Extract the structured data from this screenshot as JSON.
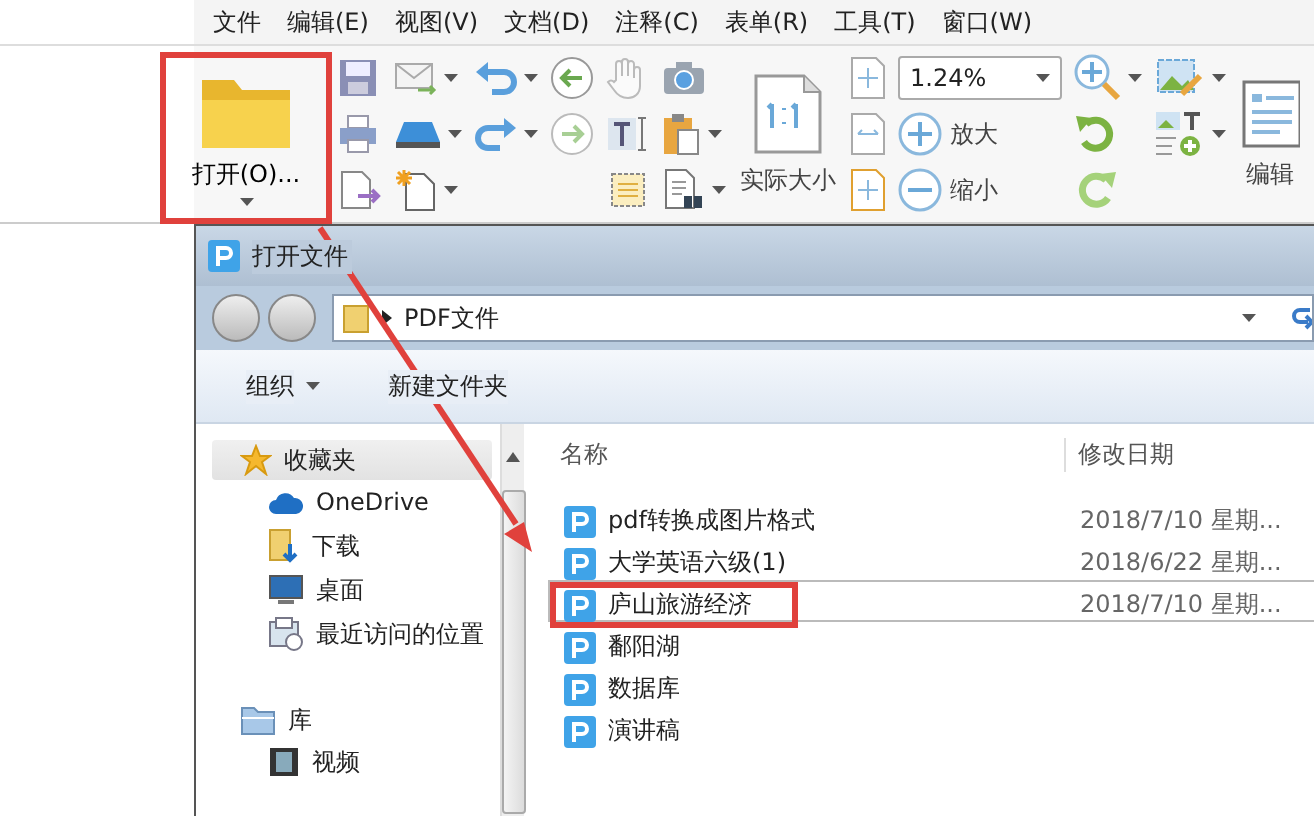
{
  "menu": [
    {
      "label": "文件"
    },
    {
      "label": "编辑(E)"
    },
    {
      "label": "视图(V)"
    },
    {
      "label": "文档(D)"
    },
    {
      "label": "注释(C)"
    },
    {
      "label": "表单(R)"
    },
    {
      "label": "工具(T)"
    },
    {
      "label": "窗口(W)"
    }
  ],
  "toolbar": {
    "open_button": {
      "label": "打开(O)...",
      "highlighted": true
    },
    "actual_size": {
      "label": "实际大小"
    },
    "zoom_field": {
      "value": "1.24%"
    },
    "zoom_in": {
      "label": "放大"
    },
    "zoom_out": {
      "label": "缩小"
    },
    "edit_button": {
      "label": "编辑"
    }
  },
  "dialog": {
    "title": "打开文件",
    "path": "PDF文件",
    "commands": [
      {
        "label": "组织",
        "dropdown": true
      },
      {
        "label": "新建文件夹",
        "dropdown": false
      }
    ],
    "nav": [
      {
        "label": "收藏夹",
        "selected": true,
        "children": [
          {
            "label": "OneDrive",
            "selected": false
          },
          {
            "label": "下载",
            "selected": false
          },
          {
            "label": "桌面",
            "selected": false
          },
          {
            "label": "最近访问的位置",
            "selected": false
          }
        ]
      },
      {
        "label": "库",
        "selected": false,
        "children": [
          {
            "label": "视频",
            "selected": false
          }
        ]
      }
    ],
    "columns": [
      "名称",
      "修改日期"
    ],
    "rows": [
      {
        "name": "pdf转换成图片格式",
        "date": "2018/7/10 星期...",
        "selected": false,
        "highlighted": false
      },
      {
        "name": "大学英语六级(1)",
        "date": "2018/6/22 星期...",
        "selected": false,
        "highlighted": false
      },
      {
        "name": "庐山旅游经济",
        "date": "2018/7/10 星期...",
        "selected": true,
        "highlighted": true
      },
      {
        "name": "鄱阳湖",
        "selected": false,
        "highlighted": false
      },
      {
        "name": "数据库",
        "selected": false,
        "highlighted": false
      },
      {
        "name": "演讲稿",
        "selected": false,
        "highlighted": false
      }
    ]
  },
  "annotation_arrow": true
}
